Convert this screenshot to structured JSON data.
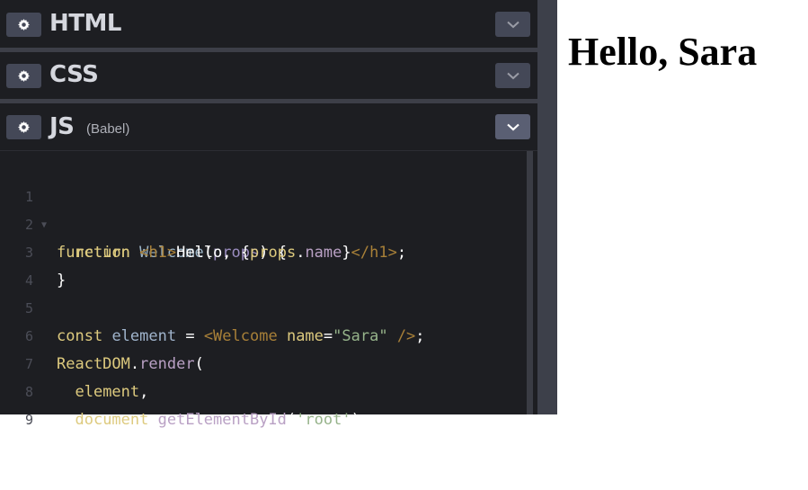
{
  "panels": {
    "html": {
      "title": "HTML"
    },
    "css": {
      "title": "CSS"
    },
    "js": {
      "title": "JS",
      "subtitle": "(Babel)"
    }
  },
  "code": {
    "line_numbers": [
      "1",
      "2",
      "3",
      "4",
      "5",
      "6",
      "7",
      "8",
      "9"
    ],
    "l1": {
      "kw": "function",
      "fn": "Welcome",
      "p1": "(",
      "arg": "props",
      "p2": ") {"
    },
    "l2": {
      "kw": "return",
      "t1": "<h1>",
      "txt": "Hello, {",
      "obj": "props",
      "dot": ".",
      "prop": "name",
      "close": "}",
      "t2": "</h1>",
      "semi": ";"
    },
    "l3": {
      "text": "}"
    },
    "l5": {
      "kw": "const",
      "var": "element",
      "eq": " = ",
      "t1": "<Welcome",
      "attr": "name",
      "eqs": "=",
      "str": "\"Sara\"",
      "t2": " />",
      "semi": ";"
    },
    "l6": {
      "obj": "ReactDOM",
      "dot": ".",
      "fn": "render",
      "p": "("
    },
    "l7": {
      "var": "element",
      "comma": ","
    },
    "l8": {
      "obj": "document",
      "dot": ".",
      "fn": "getElementById",
      "p1": "(",
      "str": "'root'",
      "p2": ")"
    },
    "l9": {
      "text": ");"
    }
  },
  "preview": {
    "heading": "Hello, Sara"
  },
  "icons": {
    "settings": "gear-icon",
    "collapse": "chevron-down-icon"
  },
  "colors": {
    "editor_bg": "#1d1e22",
    "button_bg": "#444857",
    "keyword": "#ddca7e",
    "string": "#96b38a"
  }
}
